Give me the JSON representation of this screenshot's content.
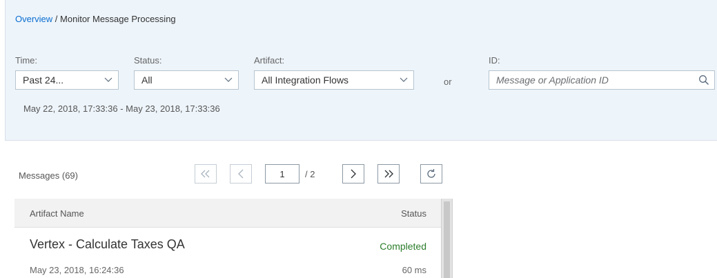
{
  "breadcrumb": {
    "overview": "Overview",
    "separator": " / ",
    "current": "Monitor Message Processing"
  },
  "filters": {
    "time": {
      "label": "Time:",
      "value": "Past 24..."
    },
    "status": {
      "label": "Status:",
      "value": "All"
    },
    "artifact": {
      "label": "Artifact:",
      "value": "All Integration Flows"
    },
    "or_text": "or",
    "id": {
      "label": "ID:",
      "placeholder": "Message or Application ID"
    },
    "date_range": "May 22, 2018, 17:33:36 - May 23, 2018, 17:33:36"
  },
  "messages": {
    "title": "Messages (69)",
    "pagination": {
      "current_page": "1",
      "total": "/ 2"
    },
    "columns": {
      "name": "Artifact Name",
      "status": "Status"
    },
    "rows": [
      {
        "name": "Vertex - Calculate Taxes QA",
        "status": "Completed",
        "date": "May 23, 2018, 16:24:36",
        "duration": "60 ms"
      }
    ]
  },
  "colors": {
    "link": "#0a6ed1",
    "filter_background": "#edf4fa",
    "status_completed": "#2b7d2b"
  },
  "icons": {
    "dropdown": "chevron-down-icon",
    "search": "search-icon",
    "first_page": "double-chevron-left-icon",
    "previous_page": "chevron-left-icon",
    "next_page": "chevron-right-icon",
    "last_page": "double-chevron-right-icon",
    "refresh": "refresh-icon"
  }
}
